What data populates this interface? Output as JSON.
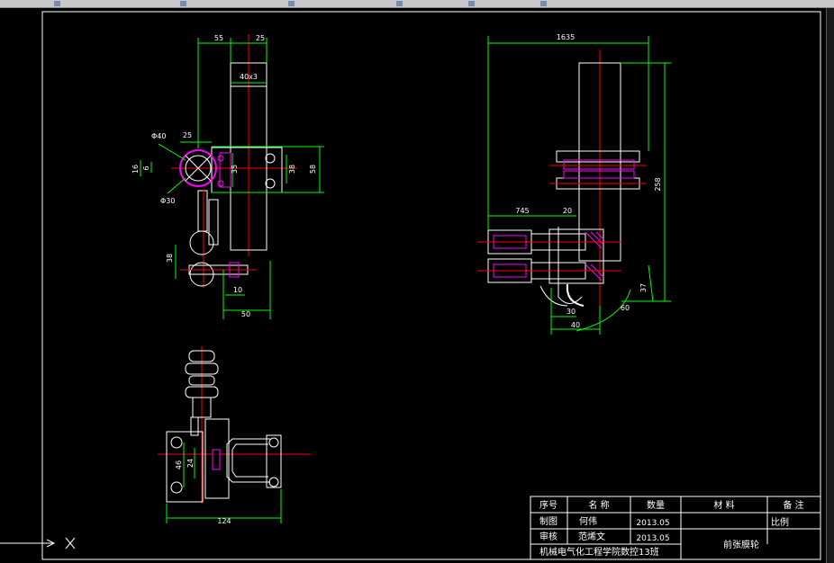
{
  "drawing": {
    "top_view_dims": {
      "d55": "55",
      "d25a": "25",
      "d40x3": "40x3",
      "phi40": "Φ40",
      "d25b": "25",
      "d16": "16",
      "d6": "6",
      "d35": "35",
      "d38a": "38",
      "d58": "58",
      "phi30": "Φ30",
      "d38b": "38",
      "d10": "10",
      "d50": "50"
    },
    "side_view_dims": {
      "d1635": "1635",
      "d745": "745",
      "d20": "20",
      "d258": "258",
      "d37": "37",
      "d30": "30",
      "d40": "40",
      "d60": "60"
    },
    "bottom_view_dims": {
      "d46": "46",
      "d24": "24",
      "d124": "124"
    }
  },
  "title_block": {
    "headers": {
      "no": "序号",
      "name": "名  称",
      "qty": "数量",
      "material": "材  料",
      "note": "备  注"
    },
    "rows": [
      {
        "role": "制图",
        "person": "何伟",
        "date": "2013.05",
        "extra": "比例"
      },
      {
        "role": "审核",
        "person": "范烯文",
        "date": "2013.05"
      }
    ],
    "school": "机械电气化工程学院数控13班",
    "part_name": "前张膜轮"
  },
  "colors": {
    "background": "#000000",
    "outline": "#ffffff",
    "dimension": "#00ff00",
    "centerline": "#ff0000",
    "hatch": "#ff00ff",
    "accent": "#ffff00"
  }
}
